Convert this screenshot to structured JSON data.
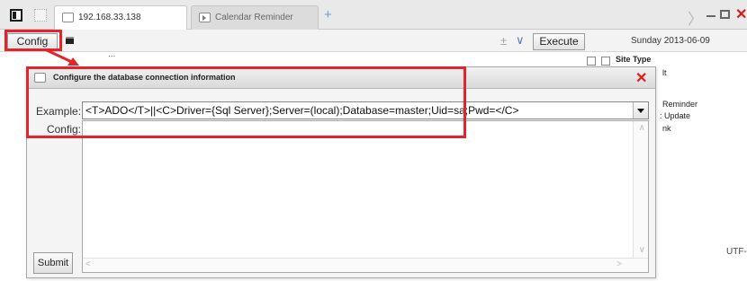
{
  "tabbar": {
    "tabs": [
      {
        "label": "192.168.33.138",
        "icon": "page-icon",
        "active": true
      },
      {
        "label": "Calendar Reminder",
        "icon": "calendar-play-icon",
        "active": false
      }
    ],
    "new_tab_symbol": "+",
    "window_controls": {
      "forward": "〉",
      "minimize": "minimize-icon",
      "maximize": "maximize-icon",
      "close": "✕"
    }
  },
  "toolbar": {
    "config_label": "Config",
    "expand_symbol": "±",
    "dropdown_symbol": "∨",
    "execute_label": "Execute",
    "date": "Sunday 2013-06-09"
  },
  "background": {
    "dots": "...",
    "site_type": "Site Type",
    "fragments": {
      "lt": "lt",
      "reminder": "Reminder",
      "update": ": Update",
      "nk": "nk"
    },
    "encoding": "UTF-"
  },
  "dialog": {
    "title": "Configure the database connection information",
    "close_symbol": "✕",
    "example_label": "Example:",
    "example_value": "<T>ADO</T>||<C>Driver={Sql Server};Server=(local);Database=master;Uid=sa;Pwd=</C>",
    "config_label": "Config:",
    "config_value": "",
    "submit_label": "Submit"
  },
  "colors": {
    "annotation_red": "#e5232b",
    "close_red": "#e01b1b"
  }
}
